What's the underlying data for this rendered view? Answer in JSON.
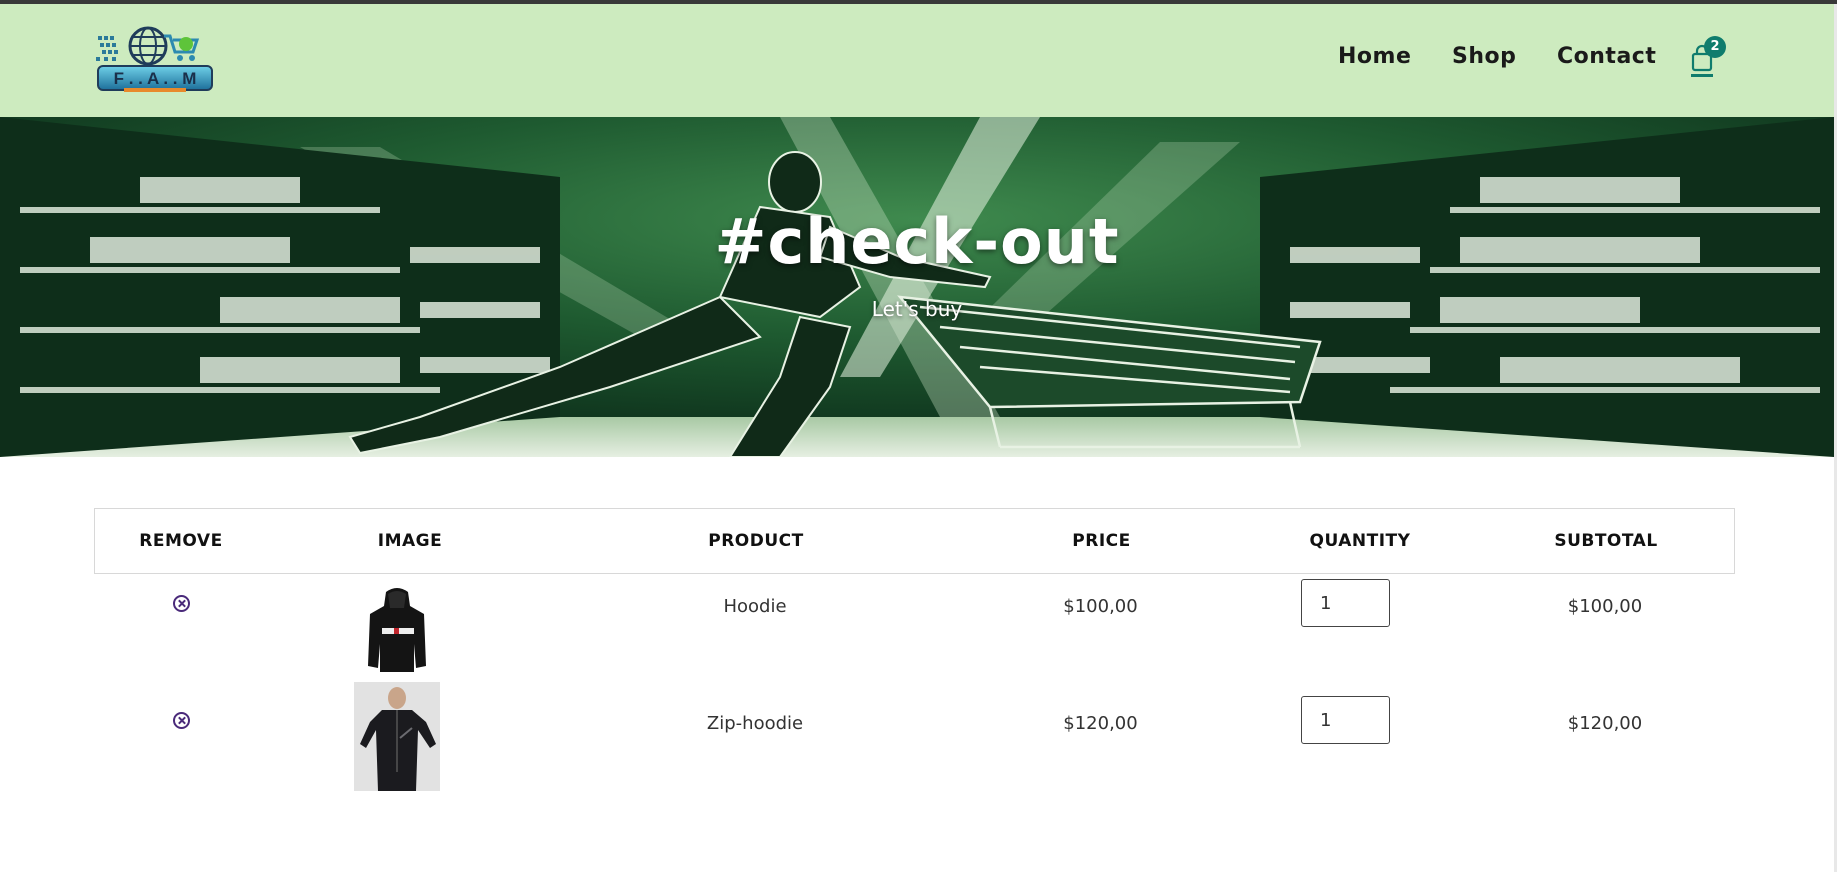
{
  "header": {
    "logo_text": "F.A.M",
    "nav": {
      "home": "Home",
      "shop": "Shop",
      "contact": "Contact"
    },
    "cart_count": "2",
    "colors": {
      "background": "#cdebbf",
      "accent": "#0f7c6d"
    }
  },
  "hero": {
    "title": "#check-out",
    "subtitle": "Let's buy"
  },
  "cart": {
    "columns": [
      "REMOVE",
      "IMAGE",
      "PRODUCT",
      "PRICE",
      "QUANTITY",
      "SUBTOTAL"
    ],
    "items": [
      {
        "product": "Hoodie",
        "price": "$100,00",
        "quantity": "1",
        "subtotal": "$100,00",
        "image": "black-hoodie-image"
      },
      {
        "product": "Zip-hoodie",
        "price": "$120,00",
        "quantity": "1",
        "subtotal": "$120,00",
        "image": "black-zip-hoodie-model-image"
      }
    ]
  }
}
